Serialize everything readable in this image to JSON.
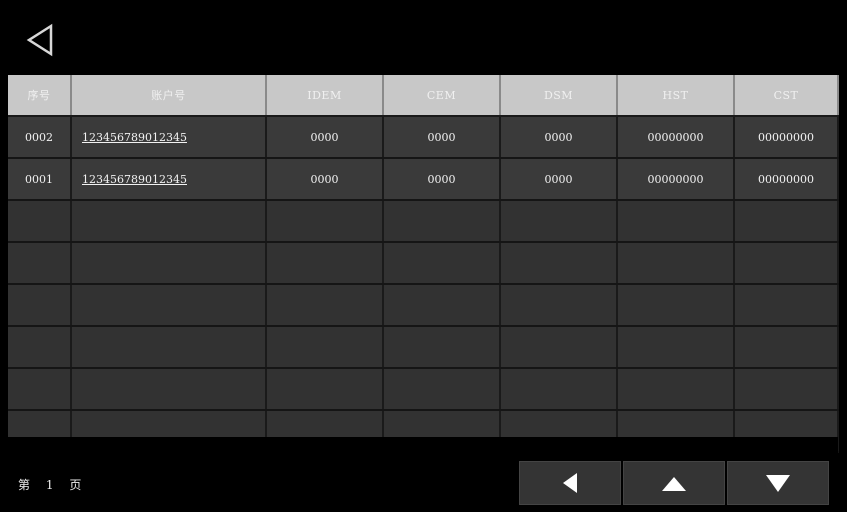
{
  "table": {
    "headers": [
      "序号",
      "账户号",
      "IDEM",
      "CEM",
      "DSM",
      "HST",
      "CST"
    ],
    "rows": [
      [
        "0002",
        "123456789012345",
        "0000",
        "0000",
        "0000",
        "00000000",
        "00000000"
      ],
      [
        "0001",
        "123456789012345",
        "0000",
        "0000",
        "0000",
        "00000000",
        "00000000"
      ]
    ],
    "empty_rows": 6
  },
  "pager": {
    "prefix": "第",
    "current": "1",
    "suffix": "页"
  },
  "icons": {
    "back": "back-icon",
    "prev": "triangle-left-icon",
    "up": "triangle-up-icon",
    "down": "triangle-down-icon"
  }
}
